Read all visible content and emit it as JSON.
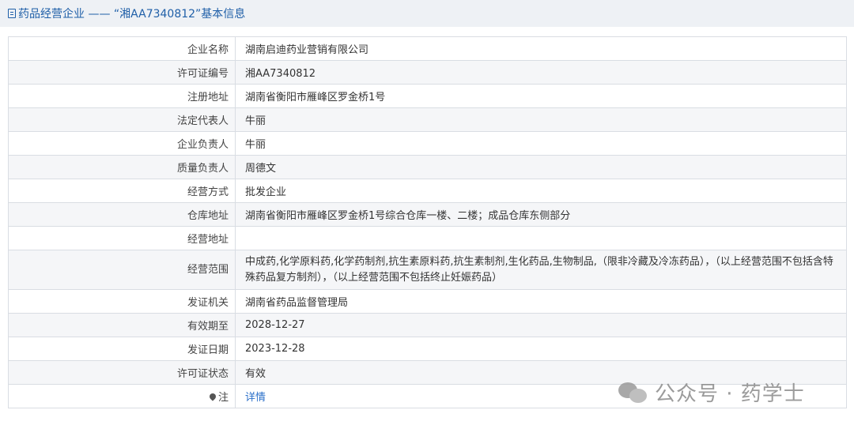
{
  "header": {
    "title": "药品经营企业 —— “湘AA7340812”基本信息"
  },
  "rows": [
    {
      "label": "企业名称",
      "value": "湖南启迪药业营销有限公司"
    },
    {
      "label": "许可证编号",
      "value": "湘AA7340812"
    },
    {
      "label": "注册地址",
      "value": "湖南省衡阳市雁峰区罗金桥1号"
    },
    {
      "label": "法定代表人",
      "value": "牛丽"
    },
    {
      "label": "企业负责人",
      "value": "牛丽"
    },
    {
      "label": "质量负责人",
      "value": "周德文"
    },
    {
      "label": "经营方式",
      "value": "批发企业"
    },
    {
      "label": "仓库地址",
      "value": "湖南省衡阳市雁峰区罗金桥1号综合仓库一楼、二楼；成品仓库东侧部分"
    },
    {
      "label": "经营地址",
      "value": ""
    },
    {
      "label": "经营范围",
      "value": "中成药,化学原料药,化学药制剂,抗生素原料药,抗生素制剂,生化药品,生物制品,（限非冷藏及冷冻药品），（以上经营范围不包括含特殊药品复方制剂），（以上经营范围不包括终止妊娠药品）"
    },
    {
      "label": "发证机关",
      "value": "湖南省药品监督管理局"
    },
    {
      "label": "有效期至",
      "value": "2028-12-27"
    },
    {
      "label": "发证日期",
      "value": "2023-12-28"
    },
    {
      "label": "许可证状态",
      "value": "有效"
    }
  ],
  "note": {
    "label": "注",
    "link_text": "详情"
  },
  "watermark": {
    "text": "公众号 · 药学士"
  }
}
